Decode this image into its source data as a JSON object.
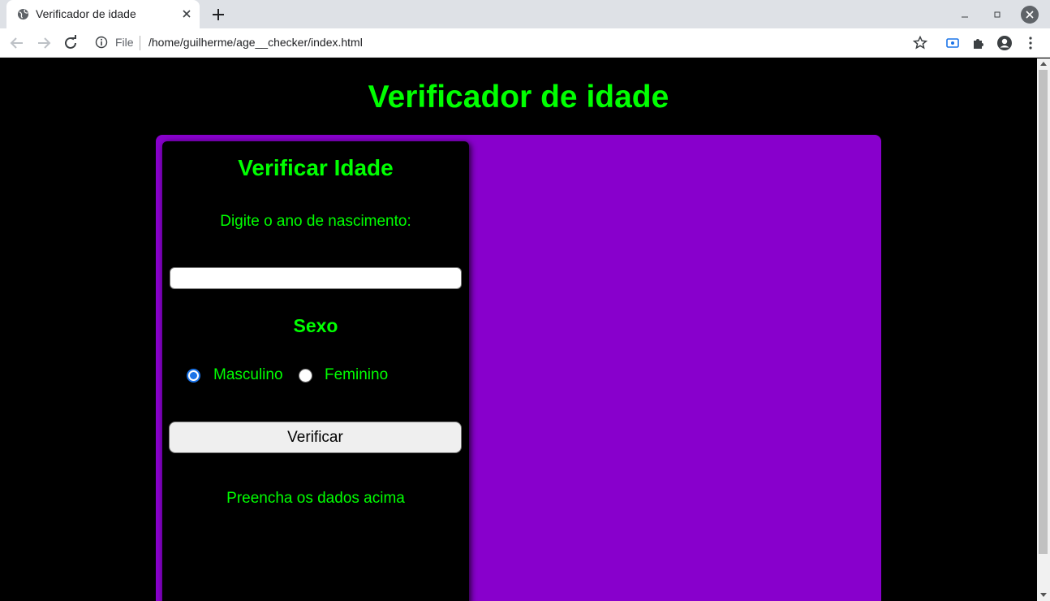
{
  "browser": {
    "tab_title": "Verificador de idade",
    "scheme_label": "File",
    "url": "/home/guilherme/age__checker/index.html"
  },
  "icons": {
    "favicon": "globe-icon",
    "tab_close": "close-icon",
    "new_tab": "plus-icon",
    "back": "arrow-left-icon",
    "forward": "arrow-right-icon",
    "reload": "reload-icon",
    "info": "info-icon",
    "bookmark": "star-icon",
    "cast": "cast-icon",
    "extensions": "puzzle-icon",
    "profile": "account-icon",
    "menu": "kebab-menu-icon"
  },
  "page": {
    "title": "Verificador de idade"
  },
  "form": {
    "heading": "Verificar Idade",
    "year_label": "Digite o ano de nascimento:",
    "year_value": "",
    "sexo_label": "Sexo",
    "options": [
      {
        "label": "Masculino",
        "checked": true
      },
      {
        "label": "Feminino",
        "checked": false
      }
    ],
    "button_label": "Verificar",
    "result_text": "Preencha os dados acima"
  },
  "colors": {
    "accent_text": "#00ff00",
    "container": "#8800cc",
    "panel": "#000000",
    "radio_selected": "#1a73e8"
  }
}
